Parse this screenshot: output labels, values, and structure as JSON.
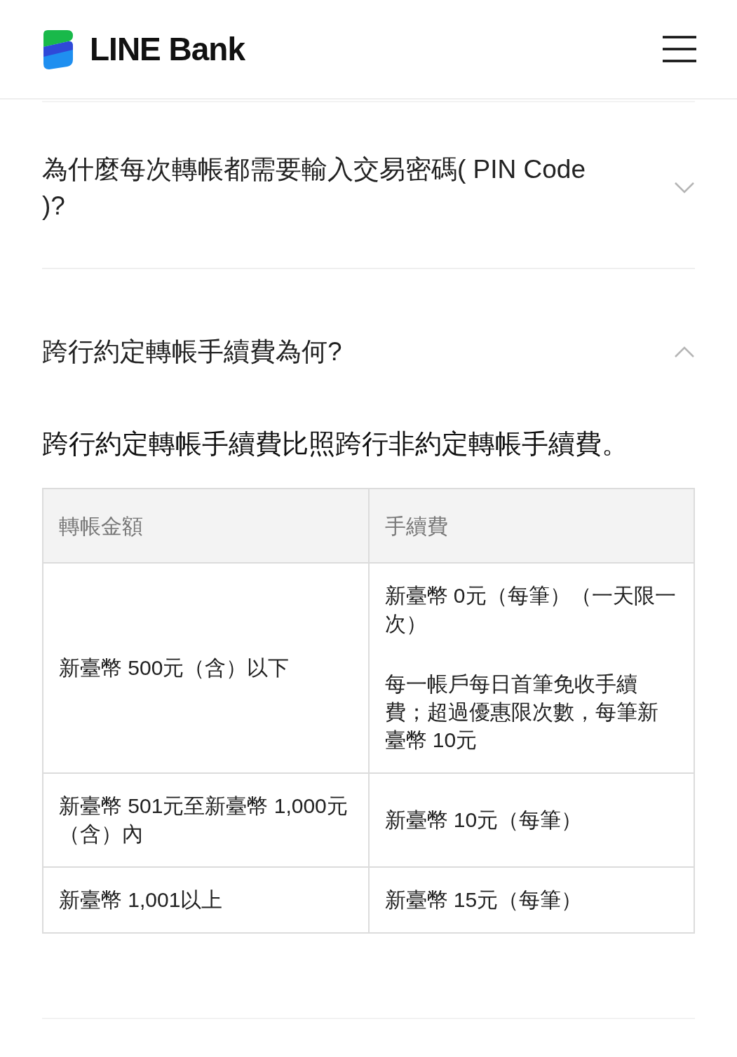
{
  "header": {
    "logo_text": "LINE Bank"
  },
  "faq": [
    {
      "question": "為什麼每次轉帳都需要輸入交易密碼( PIN Code )?",
      "expanded": false
    },
    {
      "question": "跨行約定轉帳手續費為何?",
      "expanded": true,
      "answer": {
        "text": "跨行約定轉帳手續費比照跨行非約定轉帳手續費。",
        "table": {
          "columns": [
            "轉帳金額",
            "手續費"
          ],
          "rows": [
            {
              "amount": "新臺幣 500元（含）以下",
              "fee": [
                "新臺幣 0元（每筆）（一天限一次）",
                "每一帳戶每日首筆免收手續費；超過優惠限次數，每筆新臺幣 10元"
              ]
            },
            {
              "amount": "新臺幣 501元至新臺幣 1,000元（含）內",
              "fee": [
                "新臺幣 10元（每筆）"
              ]
            },
            {
              "amount": "新臺幣 1,001以上",
              "fee": [
                "新臺幣 15元（每筆）"
              ]
            }
          ]
        }
      }
    }
  ]
}
